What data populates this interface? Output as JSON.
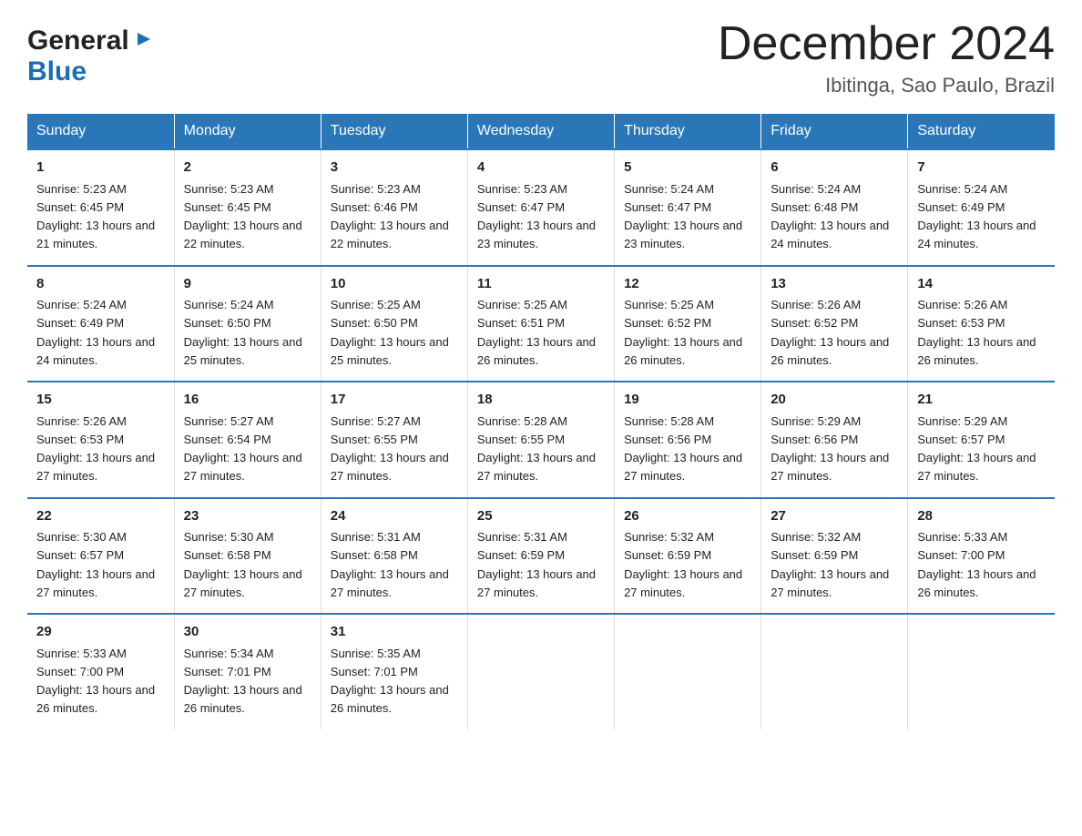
{
  "header": {
    "logo_general": "General",
    "logo_blue": "Blue",
    "main_title": "December 2024",
    "subtitle": "Ibitinga, Sao Paulo, Brazil"
  },
  "days_of_week": [
    "Sunday",
    "Monday",
    "Tuesday",
    "Wednesday",
    "Thursday",
    "Friday",
    "Saturday"
  ],
  "weeks": [
    [
      {
        "day": "1",
        "sunrise": "5:23 AM",
        "sunset": "6:45 PM",
        "daylight": "13 hours and 21 minutes."
      },
      {
        "day": "2",
        "sunrise": "5:23 AM",
        "sunset": "6:45 PM",
        "daylight": "13 hours and 22 minutes."
      },
      {
        "day": "3",
        "sunrise": "5:23 AM",
        "sunset": "6:46 PM",
        "daylight": "13 hours and 22 minutes."
      },
      {
        "day": "4",
        "sunrise": "5:23 AM",
        "sunset": "6:47 PM",
        "daylight": "13 hours and 23 minutes."
      },
      {
        "day": "5",
        "sunrise": "5:24 AM",
        "sunset": "6:47 PM",
        "daylight": "13 hours and 23 minutes."
      },
      {
        "day": "6",
        "sunrise": "5:24 AM",
        "sunset": "6:48 PM",
        "daylight": "13 hours and 24 minutes."
      },
      {
        "day": "7",
        "sunrise": "5:24 AM",
        "sunset": "6:49 PM",
        "daylight": "13 hours and 24 minutes."
      }
    ],
    [
      {
        "day": "8",
        "sunrise": "5:24 AM",
        "sunset": "6:49 PM",
        "daylight": "13 hours and 24 minutes."
      },
      {
        "day": "9",
        "sunrise": "5:24 AM",
        "sunset": "6:50 PM",
        "daylight": "13 hours and 25 minutes."
      },
      {
        "day": "10",
        "sunrise": "5:25 AM",
        "sunset": "6:50 PM",
        "daylight": "13 hours and 25 minutes."
      },
      {
        "day": "11",
        "sunrise": "5:25 AM",
        "sunset": "6:51 PM",
        "daylight": "13 hours and 26 minutes."
      },
      {
        "day": "12",
        "sunrise": "5:25 AM",
        "sunset": "6:52 PM",
        "daylight": "13 hours and 26 minutes."
      },
      {
        "day": "13",
        "sunrise": "5:26 AM",
        "sunset": "6:52 PM",
        "daylight": "13 hours and 26 minutes."
      },
      {
        "day": "14",
        "sunrise": "5:26 AM",
        "sunset": "6:53 PM",
        "daylight": "13 hours and 26 minutes."
      }
    ],
    [
      {
        "day": "15",
        "sunrise": "5:26 AM",
        "sunset": "6:53 PM",
        "daylight": "13 hours and 27 minutes."
      },
      {
        "day": "16",
        "sunrise": "5:27 AM",
        "sunset": "6:54 PM",
        "daylight": "13 hours and 27 minutes."
      },
      {
        "day": "17",
        "sunrise": "5:27 AM",
        "sunset": "6:55 PM",
        "daylight": "13 hours and 27 minutes."
      },
      {
        "day": "18",
        "sunrise": "5:28 AM",
        "sunset": "6:55 PM",
        "daylight": "13 hours and 27 minutes."
      },
      {
        "day": "19",
        "sunrise": "5:28 AM",
        "sunset": "6:56 PM",
        "daylight": "13 hours and 27 minutes."
      },
      {
        "day": "20",
        "sunrise": "5:29 AM",
        "sunset": "6:56 PM",
        "daylight": "13 hours and 27 minutes."
      },
      {
        "day": "21",
        "sunrise": "5:29 AM",
        "sunset": "6:57 PM",
        "daylight": "13 hours and 27 minutes."
      }
    ],
    [
      {
        "day": "22",
        "sunrise": "5:30 AM",
        "sunset": "6:57 PM",
        "daylight": "13 hours and 27 minutes."
      },
      {
        "day": "23",
        "sunrise": "5:30 AM",
        "sunset": "6:58 PM",
        "daylight": "13 hours and 27 minutes."
      },
      {
        "day": "24",
        "sunrise": "5:31 AM",
        "sunset": "6:58 PM",
        "daylight": "13 hours and 27 minutes."
      },
      {
        "day": "25",
        "sunrise": "5:31 AM",
        "sunset": "6:59 PM",
        "daylight": "13 hours and 27 minutes."
      },
      {
        "day": "26",
        "sunrise": "5:32 AM",
        "sunset": "6:59 PM",
        "daylight": "13 hours and 27 minutes."
      },
      {
        "day": "27",
        "sunrise": "5:32 AM",
        "sunset": "6:59 PM",
        "daylight": "13 hours and 27 minutes."
      },
      {
        "day": "28",
        "sunrise": "5:33 AM",
        "sunset": "7:00 PM",
        "daylight": "13 hours and 26 minutes."
      }
    ],
    [
      {
        "day": "29",
        "sunrise": "5:33 AM",
        "sunset": "7:00 PM",
        "daylight": "13 hours and 26 minutes."
      },
      {
        "day": "30",
        "sunrise": "5:34 AM",
        "sunset": "7:01 PM",
        "daylight": "13 hours and 26 minutes."
      },
      {
        "day": "31",
        "sunrise": "5:35 AM",
        "sunset": "7:01 PM",
        "daylight": "13 hours and 26 minutes."
      },
      null,
      null,
      null,
      null
    ]
  ]
}
